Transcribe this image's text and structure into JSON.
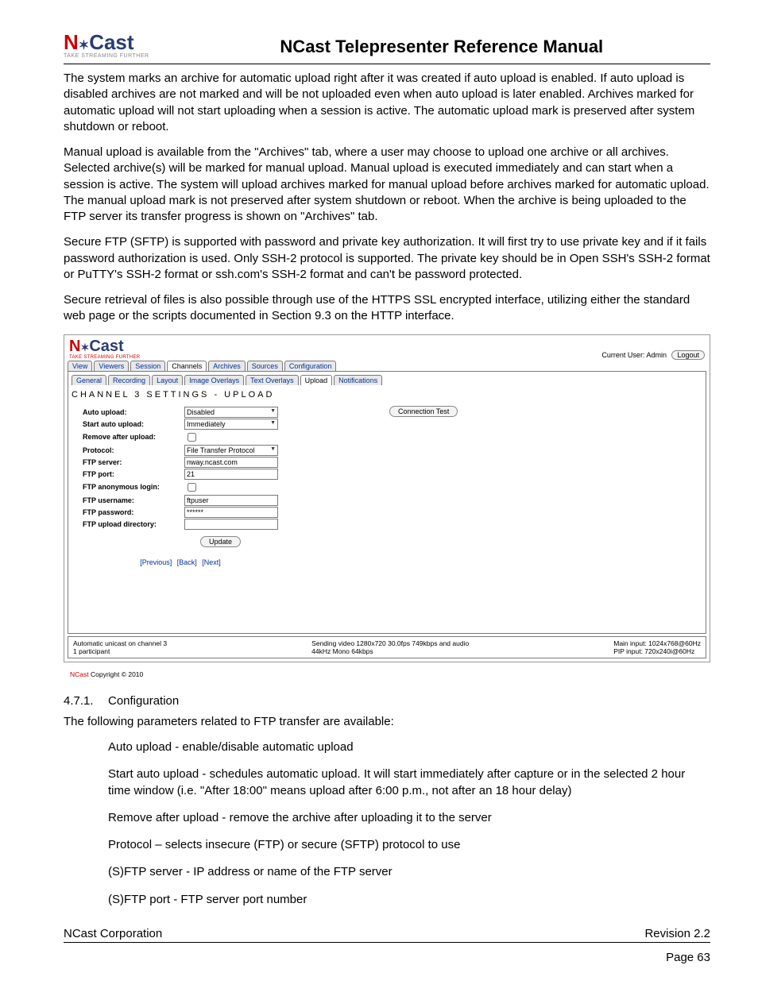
{
  "logo": {
    "n": "N",
    "star": "✶",
    "ast": "Cast",
    "sub": "TAKE STREAMING FURTHER"
  },
  "title": "NCast Telepresenter Reference Manual",
  "paras": {
    "p1": "The system marks an archive for automatic upload right after it was created if auto upload is enabled. If auto upload is disabled archives are not marked and will be not uploaded even when auto upload is later enabled. Archives marked for automatic upload will not start uploading when a session is active. The automatic upload mark is preserved after system shutdown or reboot.",
    "p2": "Manual upload is available from the \"Archives\" tab, where a user may choose to upload one archive or all archives. Selected archive(s) will be marked for manual upload. Manual upload is executed immediately and can start when a session is active. The system will upload archives marked for manual upload before archives marked for automatic upload. The manual upload mark is not preserved after system shutdown or reboot. When the archive is being uploaded to the FTP server its transfer progress is shown on \"Archives\" tab.",
    "p3": "Secure FTP (SFTP) is supported with password and private key authorization. It will first try to use private key and if it fails password authorization is used. Only SSH-2 protocol is supported. The private key should be in Open SSH's SSH-2 format or PuTTY's SSH-2 format or ssh.com's SSH-2 format and can't be password protected.",
    "p4": "Secure retrieval of files is also possible through use of the HTTPS SSL encrypted interface, utilizing either the standard web page or the scripts documented in Section 9.3 on the HTTP interface."
  },
  "shot": {
    "current_user": "Current User: Admin",
    "logout": "Logout",
    "connection_test": "Connection Test",
    "tabs": [
      "View",
      "Viewers",
      "Session",
      "Channels",
      "Archives",
      "Sources",
      "Configuration"
    ],
    "active_tab": 3,
    "subtabs": [
      "General",
      "Recording",
      "Layout",
      "Image Overlays",
      "Text Overlays",
      "Upload",
      "Notifications"
    ],
    "active_subtab": 5,
    "heading": "CHANNEL 3 SETTINGS - UPLOAD",
    "labels": {
      "auto_upload": "Auto upload:",
      "start_auto": "Start auto upload:",
      "remove_after": "Remove after upload:",
      "protocol": "Protocol:",
      "ftp_server": "FTP server:",
      "ftp_port": "FTP port:",
      "ftp_anon": "FTP anonymous login:",
      "ftp_user": "FTP username:",
      "ftp_pass": "FTP password:",
      "ftp_dir": "FTP upload directory:"
    },
    "values": {
      "auto_upload": "Disabled",
      "start_auto": "Immediately",
      "protocol": "File Transfer Protocol",
      "ftp_server": "nway.ncast.com",
      "ftp_port": "21",
      "ftp_user": "ftpuser",
      "ftp_pass": "******",
      "ftp_dir": ""
    },
    "update": "Update",
    "nav": {
      "prev": "[Previous]",
      "back": "[Back]",
      "next": "[Next]"
    },
    "status": {
      "left1": "Automatic unicast on channel 3",
      "left2": "1 participant",
      "mid1": "Sending video 1280x720 30.0fps 749kbps and audio",
      "mid2": "44kHz Mono 64kbps",
      "right1": "Main input: 1024x768@60Hz",
      "right2": "PIP input: 720x240i@60Hz"
    },
    "copyright_nc": "NCast",
    "copyright_rest": " Copyright © 2010"
  },
  "section": {
    "num": "4.7.1.",
    "title": "Configuration",
    "intro": "The following parameters related to FTP transfer are available:",
    "items": [
      "Auto upload - enable/disable automatic upload",
      "Start auto upload - schedules automatic upload. It will start immediately after capture or in the selected 2 hour time window (i.e. \"After 18:00\" means upload after 6:00 p.m., not after an 18 hour delay)",
      "Remove after upload - remove the archive after uploading it to the server",
      "Protocol – selects insecure (FTP) or secure (SFTP) protocol to use",
      "(S)FTP server - IP address or name of the FTP server",
      "(S)FTP port - FTP server port number"
    ]
  },
  "footer": {
    "left": "NCast Corporation",
    "right": "Revision 2.2",
    "page": "Page 63"
  }
}
